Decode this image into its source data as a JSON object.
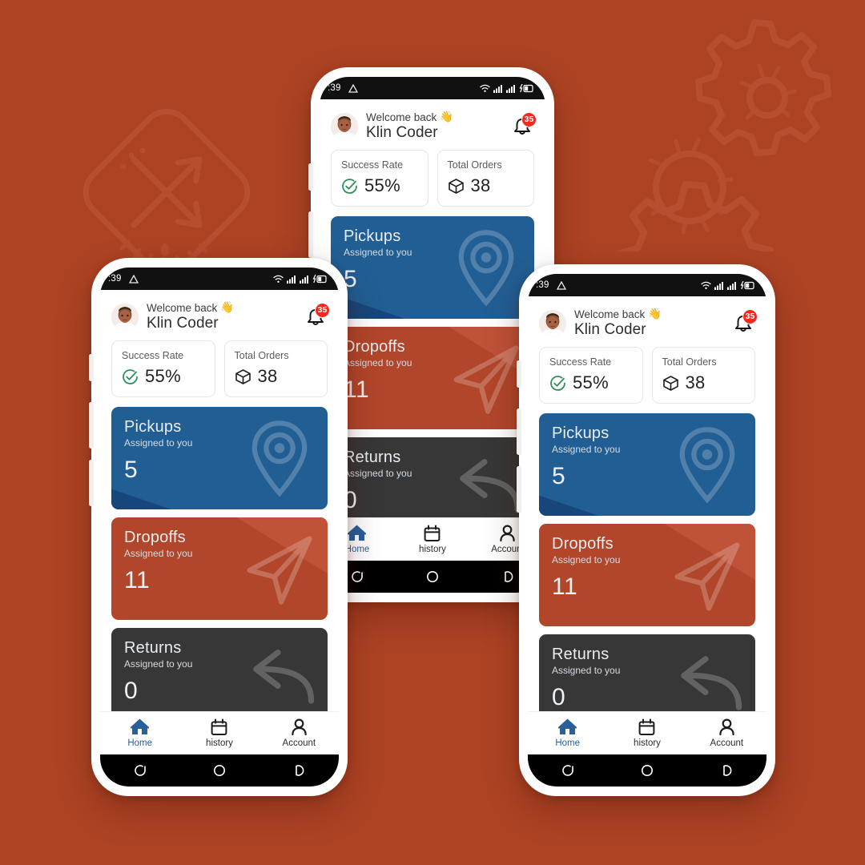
{
  "background": {
    "color": "#ae4324",
    "doodles": [
      "compass-doodle",
      "gears-doodle"
    ]
  },
  "phones": [
    {
      "id": "phone-middle",
      "position": "back-center"
    },
    {
      "id": "phone-left",
      "position": "front-left"
    },
    {
      "id": "phone-right",
      "position": "front-right"
    }
  ],
  "statusbar": {
    "time": ":39",
    "left_icons": [
      "triangle-icon"
    ],
    "right_icons": [
      "wifi-icon",
      "signal-icon",
      "signal-icon",
      "battery-charging-icon"
    ]
  },
  "header": {
    "greeting": "Welcome back",
    "greeting_emoji": "👋",
    "user_name": "Klin Coder",
    "avatar_name": "user-avatar",
    "bell_icon": "bell-icon",
    "notification_count": "35",
    "badge_color": "#ee2b21"
  },
  "stats": [
    {
      "label": "Success Rate",
      "value": "55%",
      "icon": "check-circle-icon",
      "icon_color": "#2f8f5b"
    },
    {
      "label": "Total Orders",
      "value": "38",
      "icon": "package-box-icon",
      "icon_color": "#1c1c1c"
    }
  ],
  "cards": [
    {
      "title": "Pickups",
      "subtitle": "Assigned to you",
      "count": "5",
      "color": "#215e94",
      "icon": "location-pin-icon"
    },
    {
      "title": "Dropoffs",
      "subtitle": "Assigned to you",
      "count": "11",
      "color": "#b2462a",
      "icon": "paper-plane-icon"
    },
    {
      "title": "Returns",
      "subtitle": "Assigned to you",
      "count": "0",
      "color": "#373737",
      "icon": "return-arrow-icon"
    }
  ],
  "bottom_nav": {
    "items": [
      {
        "label": "Home",
        "icon": "home-icon",
        "active": true
      },
      {
        "label": "history",
        "icon": "calendar-icon",
        "active": false
      },
      {
        "label": "Account",
        "icon": "person-icon",
        "active": false
      }
    ],
    "active_color": "#2a6099"
  },
  "system_bar": {
    "buttons": [
      {
        "name": "recents-button"
      },
      {
        "name": "home-button"
      },
      {
        "name": "back-button"
      }
    ]
  }
}
